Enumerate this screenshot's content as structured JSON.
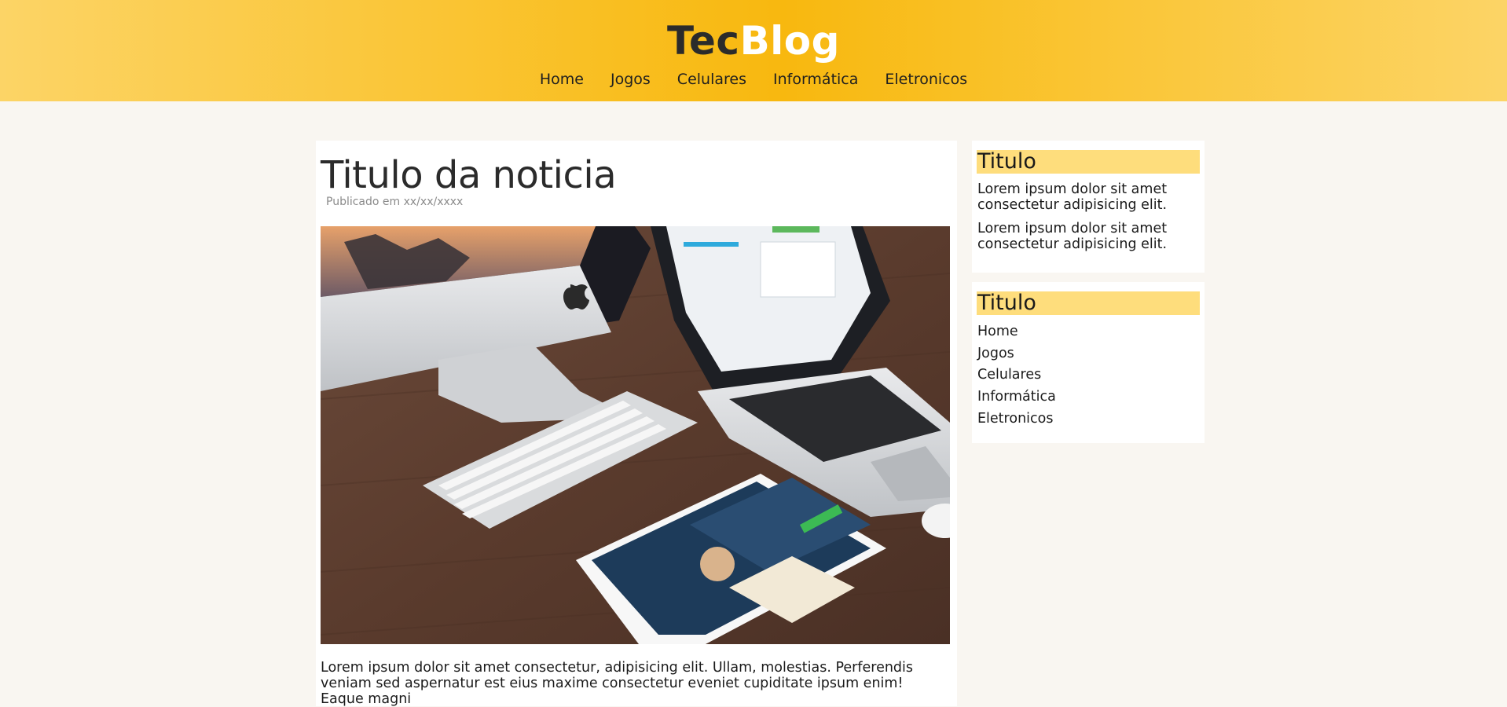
{
  "header": {
    "logo_part1": "Tec",
    "logo_part2": "Blog",
    "nav": [
      {
        "label": "Home"
      },
      {
        "label": "Jogos"
      },
      {
        "label": "Celulares"
      },
      {
        "label": "Informática"
      },
      {
        "label": "Eletronicos"
      }
    ]
  },
  "article": {
    "title": "Titulo da noticia",
    "published": "Publicado em xx/xx/xxxx",
    "body": "Lorem ipsum dolor sit amet consectetur, adipisicing elit. Ullam, molestias. Perferendis veniam sed aspernatur est eius maxime consectetur eveniet cupiditate ipsum enim! Eaque magni"
  },
  "sidebar": {
    "widget1": {
      "title": "Titulo",
      "paragraphs": [
        "Lorem ipsum dolor sit amet consectetur adipisicing elit.",
        "Lorem ipsum dolor sit amet consectetur adipisicing elit."
      ]
    },
    "widget2": {
      "title": "Titulo",
      "links": [
        {
          "label": "Home"
        },
        {
          "label": "Jogos"
        },
        {
          "label": "Celulares"
        },
        {
          "label": "Informática"
        },
        {
          "label": "Eletronicos"
        }
      ]
    }
  },
  "colors": {
    "header_accent": "#f8b80f",
    "widget_title_bg": "#fedd7c",
    "page_bg": "#f9f6f1"
  }
}
